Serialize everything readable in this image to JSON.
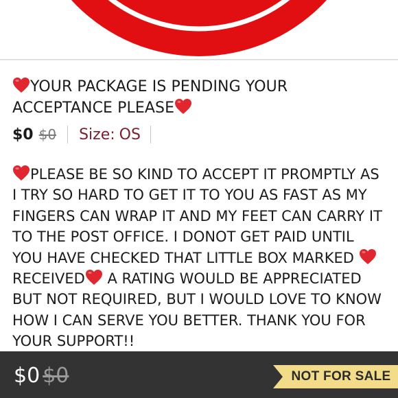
{
  "listing": {
    "title_line1": "YOUR PACKAGE IS PENDING YOUR",
    "title_line2": "ACCEPTANCE PLEASE",
    "price_current": "$0",
    "price_original": "$0",
    "size_label": "Size:",
    "size_value": "OS",
    "description": {
      "part1": "PLEASE BE SO KIND TO ACCEPT IT PROMPTLY AS I TRY SO HARD TO GET IT TO YOU AS FAST AS MY FINGERS CAN WRAP IT AND MY FEET CAN CARRY IT TO THE POST OFFICE.  I DONOT GET PAID UNTIL YOU HAVE CHECKED THAT LITTLE BOX MARKED ",
      "part2": "RECEIVED",
      "part3": " A RATING WOULD BE APPRECIATED BUT NOT REQUIRED, BUT I WOULD LOVE TO KNOW HOW I CAN SERVE YOU BETTER. THANK YOU FOR YOUR SUPPORT!!"
    }
  },
  "bottom_bar": {
    "price_current": "$0",
    "price_original": "$0",
    "badge_label": "NOT FOR SALE"
  },
  "colors": {
    "hero_red": "#e10f12",
    "heart_red": "#e0262e",
    "size_color": "#7b1f2f",
    "bottom_bar_bg": "#333333",
    "banner_gold": "#f2dc8a"
  },
  "icons": {
    "heart": "red-heart-icon"
  }
}
